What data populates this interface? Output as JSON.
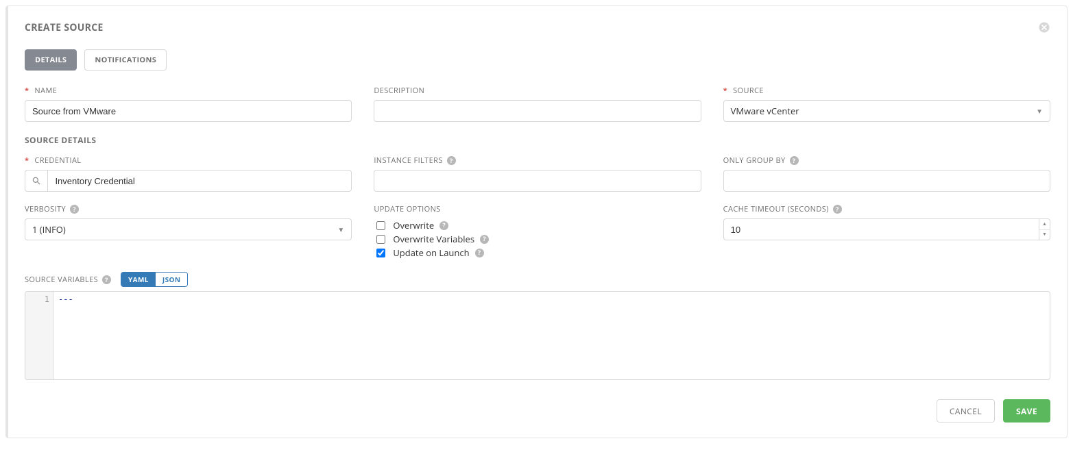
{
  "header": {
    "title": "CREATE SOURCE"
  },
  "tabs": {
    "details": "DETAILS",
    "notifications": "NOTIFICATIONS",
    "active": "details"
  },
  "fields": {
    "name": {
      "label": "NAME",
      "value": "Source from VMware",
      "required": true
    },
    "description": {
      "label": "DESCRIPTION",
      "value": ""
    },
    "source": {
      "label": "SOURCE",
      "value": "VMware vCenter",
      "required": true
    },
    "credential": {
      "label": "CREDENTIAL",
      "value": "Inventory Credential",
      "required": true
    },
    "inst_filters": {
      "label": "INSTANCE FILTERS",
      "value": ""
    },
    "group_by": {
      "label": "ONLY GROUP BY",
      "value": ""
    },
    "verbosity": {
      "label": "VERBOSITY",
      "value": "1 (INFO)"
    },
    "cache": {
      "label": "CACHE TIMEOUT (SECONDS)",
      "value": "10"
    }
  },
  "section": {
    "source_details": "SOURCE DETAILS",
    "update_options": "UPDATE OPTIONS",
    "source_vars": "SOURCE VARIABLES"
  },
  "update_options": {
    "overwrite": {
      "label": "Overwrite",
      "checked": false
    },
    "overwrite_vars": {
      "label": "Overwrite Variables",
      "checked": false
    },
    "update_launch": {
      "label": "Update on Launch",
      "checked": true
    }
  },
  "toggle": {
    "yaml": "YAML",
    "json": "JSON",
    "active": "yaml"
  },
  "editor": {
    "line_no": "1",
    "content": "---"
  },
  "buttons": {
    "cancel": "CANCEL",
    "save": "SAVE"
  }
}
